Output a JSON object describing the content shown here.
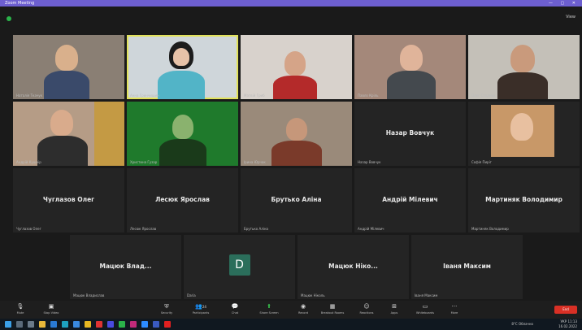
{
  "window": {
    "title": "Zoom Meeting",
    "controls": "— ▢ ✕"
  },
  "meeting": {
    "view_label": "View"
  },
  "tiles_row1": [
    {
      "sub": "Наталія Ткачук"
    },
    {
      "sub": "Анна Гринчишин"
    },
    {
      "sub": "Матвій Гриб"
    },
    {
      "sub": "Павло Кріль"
    },
    {
      "sub": "Олег Стадник"
    }
  ],
  "tiles_row2": [
    {
      "sub": "Андрій Кушнір"
    },
    {
      "sub": "Христина Гузар"
    },
    {
      "sub": "Ірина Юрчак"
    },
    {
      "name": "Назар Вовчук",
      "sub": "Назар Вовчук"
    },
    {
      "sub": "Софія Пиріг"
    }
  ],
  "tiles_row3": [
    {
      "name": "Чуглазов Олег",
      "sub": "Чуглазов Олег"
    },
    {
      "name": "Лесюк Ярослав",
      "sub": "Лесюк Ярослав"
    },
    {
      "name": "Брутько Аліна",
      "sub": "Брутько Аліна"
    },
    {
      "name": "Андрій Мілевич",
      "sub": "Андрій Мілевич"
    },
    {
      "name": "Мартиняк Володимир",
      "sub": "Мартиняк Володимир"
    }
  ],
  "tiles_row4": [
    {
      "name": "Мацюк Влад...",
      "sub": "Мацюк Владислав"
    },
    {
      "avatar": "D",
      "sub": "Daria"
    },
    {
      "name": "Мацюк Ніко...",
      "sub": "Мацюк Ніколь"
    },
    {
      "name": "Іваня Максим",
      "sub": "Іваня Максим"
    }
  ],
  "toolbar": {
    "mute": "Mute",
    "stop_video": "Stop Video",
    "security": "Security",
    "participants": "Participants",
    "participants_count": "24",
    "chat": "Chat",
    "share_screen": "Share Screen",
    "record": "Record",
    "breakout": "Breakout Rooms",
    "reactions": "Reactions",
    "apps": "Apps",
    "whiteboards": "Whiteboards",
    "more": "More",
    "end": "End"
  },
  "taskbar": {
    "weather": "8°C Облачно",
    "lang": "УКР",
    "time": "11:13",
    "date": "16.02.2022"
  },
  "colors": {
    "titlebar": "#6d5fd0",
    "end": "#d93025",
    "active_speaker": "#e1e15a",
    "avatar": "#2b6e5b"
  }
}
